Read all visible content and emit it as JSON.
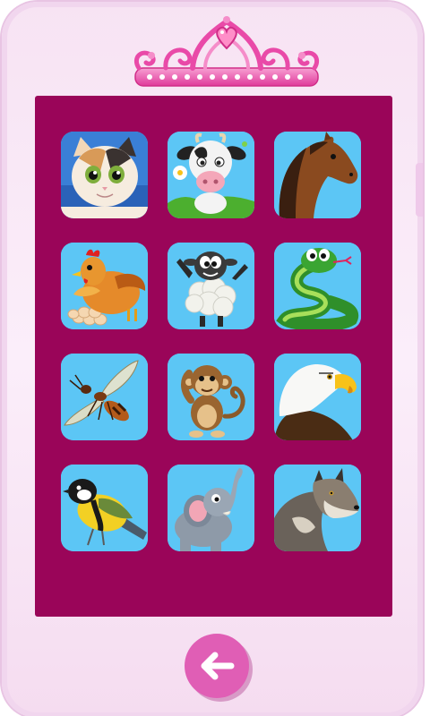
{
  "colors": {
    "phone_body": "#f7e3f3",
    "screen": "#9a0559",
    "tile": "#5cc6f5",
    "back_button": "#e05eb5",
    "tiara": "#e94aa8"
  },
  "header": {
    "tiara_icon": "tiara-icon"
  },
  "grid": {
    "tiles": [
      {
        "animal": "cat",
        "icon": "cat-icon"
      },
      {
        "animal": "cow",
        "icon": "cow-icon"
      },
      {
        "animal": "horse",
        "icon": "horse-icon"
      },
      {
        "animal": "hen",
        "icon": "hen-icon"
      },
      {
        "animal": "sheep",
        "icon": "sheep-icon"
      },
      {
        "animal": "snake",
        "icon": "snake-icon"
      },
      {
        "animal": "wasp",
        "icon": "wasp-icon"
      },
      {
        "animal": "monkey",
        "icon": "monkey-icon"
      },
      {
        "animal": "eagle",
        "icon": "eagle-icon"
      },
      {
        "animal": "bird",
        "icon": "bird-icon"
      },
      {
        "animal": "elephant",
        "icon": "elephant-icon"
      },
      {
        "animal": "wolf",
        "icon": "wolf-icon"
      }
    ]
  },
  "footer": {
    "back_icon": "back-arrow-icon"
  }
}
